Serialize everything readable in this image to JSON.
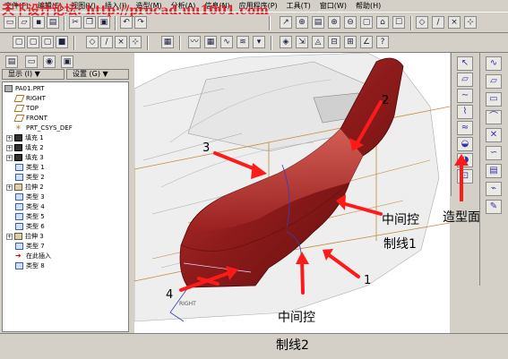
{
  "menu": [
    "文件(F)",
    "编辑(E)",
    "视图(V)",
    "插入(I)",
    "造型(M)",
    "分析(A)",
    "信息(N)",
    "应用程序(P)",
    "工具(T)",
    "窗口(W)",
    "帮助(H)"
  ],
  "watermark": "天下设计论坛: http://procad.uu1001.com",
  "left_panel": {
    "show_label": "显示 (I) ▼",
    "settings_label": "设置 (G) ▼"
  },
  "tree": [
    {
      "label": "PA01.PRT",
      "icon": "part-icon",
      "expand": false
    },
    {
      "label": "RIGHT",
      "icon": "datum-plane-icon",
      "expand": false
    },
    {
      "label": "TOP",
      "icon": "datum-plane-icon",
      "expand": false
    },
    {
      "label": "FRONT",
      "icon": "datum-plane-icon",
      "expand": false
    },
    {
      "label": "PRT_CSYS_DEF",
      "icon": "csys-icon",
      "expand": false
    },
    {
      "label": "填充 1",
      "icon": "fill-icon",
      "expand": true
    },
    {
      "label": "填充 2",
      "icon": "fill-icon",
      "expand": true
    },
    {
      "label": "填充 3",
      "icon": "fill-icon",
      "expand": true
    },
    {
      "label": "类型 1",
      "icon": "style-icon",
      "expand": false
    },
    {
      "label": "类型 2",
      "icon": "style-icon",
      "expand": false
    },
    {
      "label": "拉伸 2",
      "icon": "extrude-icon",
      "expand": true
    },
    {
      "label": "类型 3",
      "icon": "style-icon",
      "expand": false
    },
    {
      "label": "类型 4",
      "icon": "style-icon",
      "expand": false
    },
    {
      "label": "类型 5",
      "icon": "style-icon",
      "expand": false
    },
    {
      "label": "类型 6",
      "icon": "style-icon",
      "expand": false
    },
    {
      "label": "拉伸 3",
      "icon": "extrude-icon",
      "expand": true
    },
    {
      "label": "类型 7",
      "icon": "style-icon",
      "expand": false
    },
    {
      "label": "在此插入",
      "icon": "insert-arrow-icon",
      "expand": false
    },
    {
      "label": "类型 8",
      "icon": "style-icon",
      "expand": false
    }
  ],
  "annotations": {
    "n1": "1",
    "n2": "2",
    "n3": "3",
    "n4": "4",
    "mid1_line1": "中间控",
    "mid1_line2": "制线1",
    "mid2_line1": "中间控",
    "mid2_line2": "制线2",
    "surface": "造型面",
    "right_label": "RIGHT"
  },
  "colors": {
    "arrow": "#ff1a1a",
    "surface": "#8b1a1a",
    "watermark": "#e8222a"
  }
}
